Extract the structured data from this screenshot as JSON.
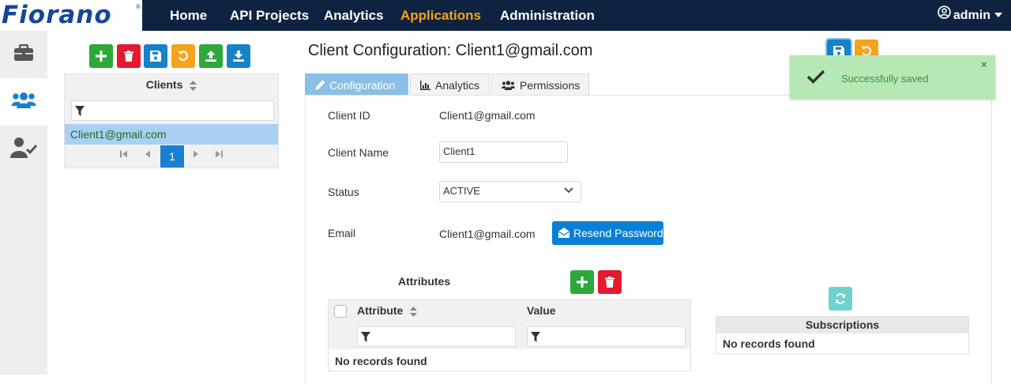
{
  "brand": {
    "name": "Fiorano",
    "reg": "®"
  },
  "nav": {
    "items": [
      "Home",
      "API Projects",
      "Analytics",
      "Applications",
      "Administration"
    ],
    "active": "Applications"
  },
  "user": {
    "name": "admin"
  },
  "sidebar": {
    "items": [
      "applications-icon",
      "clients-icon",
      "permissions-icon"
    ],
    "active": "clients-icon"
  },
  "clients": {
    "header": "Clients",
    "rows": [
      "Client1@gmail.com"
    ],
    "current_page": "1"
  },
  "config": {
    "title": "Client Configuration: Client1@gmail.com",
    "tabs": [
      "Configuration",
      "Analytics",
      "Permissions"
    ],
    "active_tab": "Configuration",
    "fields": {
      "client_id_label": "Client ID",
      "client_id_value": "Client1@gmail.com",
      "client_name_label": "Client Name",
      "client_name_value": "Client1",
      "status_label": "Status",
      "status_value": "ACTIVE",
      "email_label": "Email",
      "email_value": "Client1@gmail.com",
      "resend_label": "Resend Password"
    },
    "attributes": {
      "title": "Attributes",
      "columns": [
        "Attribute",
        "Value"
      ],
      "empty": "No records found"
    },
    "subscriptions": {
      "header": "Subscriptions",
      "empty": "No records found"
    }
  },
  "toast": {
    "message": "Successfully saved",
    "close": "×"
  },
  "colors": {
    "navbar": "#0f2341",
    "active_nav": "#f5a31a",
    "green": "#2ea83a",
    "red": "#e5192f",
    "blue": "#1682c8",
    "orange": "#f5a31a",
    "toast_bg": "#b5e8b5"
  }
}
